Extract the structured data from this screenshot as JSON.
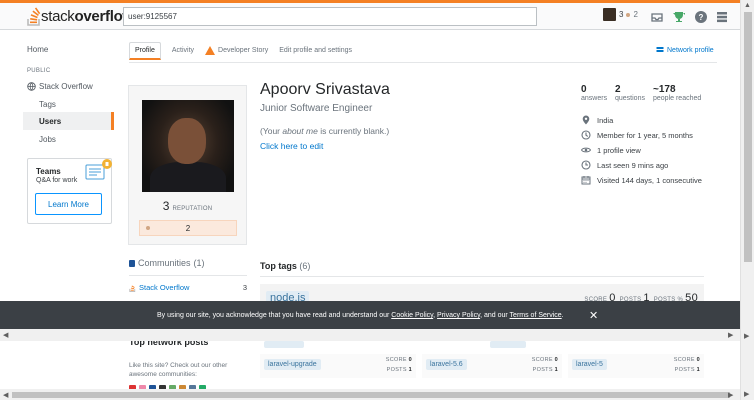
{
  "topbar": {
    "logo_text_light": "stack",
    "logo_text_bold": "overflow",
    "search_value": "user:9125567",
    "user_rep": "3",
    "user_bronze": "2"
  },
  "sidebar": {
    "home": "Home",
    "public_heading": "PUBLIC",
    "stack_overflow": "Stack Overflow",
    "tags": "Tags",
    "users": "Users",
    "jobs": "Jobs",
    "teams_title": "Teams",
    "teams_subtitle": "Q&A for work",
    "learn_more": "Learn More"
  },
  "tabs": {
    "profile": "Profile",
    "activity": "Activity",
    "developer_story": "Developer Story",
    "edit_profile": "Edit profile and settings",
    "network_profile": "Network profile"
  },
  "profile": {
    "name": "Apoorv Srivastava",
    "job_title": "Junior Software Engineer",
    "about_prefix": "(Your ",
    "about_em": "about me",
    "about_suffix": " is currently blank.)",
    "edit_link": "Click here to edit",
    "reputation": "3",
    "reputation_label": "REPUTATION",
    "bronze_badges": "2"
  },
  "stats": {
    "answers_value": "0",
    "answers_label": "answers",
    "questions_value": "2",
    "questions_label": "questions",
    "reached_value": "~178",
    "reached_label": "people reached"
  },
  "facts": {
    "location": "India",
    "member_for": "Member for 1 year, 5 months",
    "profile_views": "1 profile view",
    "last_seen": "Last seen 9 mins ago",
    "visited": "Visited 144 days, 1 consecutive"
  },
  "communities": {
    "title": "Communities",
    "count": "(1)",
    "item_name": "Stack Overflow",
    "item_rep": "3"
  },
  "top_tags": {
    "title": "Top tags",
    "count": "(6)",
    "main_tag": "node.js",
    "main_score_label": "SCORE",
    "main_score": "0",
    "main_posts_label": "POSTS",
    "main_posts": "1",
    "main_posts_pct_label": "POSTS %",
    "main_posts_pct": "50",
    "row": [
      {
        "tag": "laravel-upgrade",
        "score_label": "SCORE",
        "score": "0",
        "posts_label": "POSTS",
        "posts": "1"
      },
      {
        "tag": "laravel-5.6",
        "score_label": "SCORE",
        "score": "0",
        "posts_label": "POSTS",
        "posts": "1"
      },
      {
        "tag": "laravel-5",
        "score_label": "SCORE",
        "score": "0",
        "posts_label": "POSTS",
        "posts": "1"
      }
    ]
  },
  "network_posts": {
    "title": "Top network posts",
    "desc": "Like this site? Check out our other awesome communities:"
  },
  "cookie": {
    "prefix": "By using our site, you acknowledge that you have read and understand our ",
    "cookie_policy": "Cookie Policy",
    "sep1": ", ",
    "privacy_policy": "Privacy Policy",
    "sep2": ", and our ",
    "terms": "Terms of Service",
    "end": ".",
    "close": "✕"
  },
  "colors": {
    "accent": "#f48024",
    "link": "#0077cc",
    "banner": "#3b4045"
  }
}
